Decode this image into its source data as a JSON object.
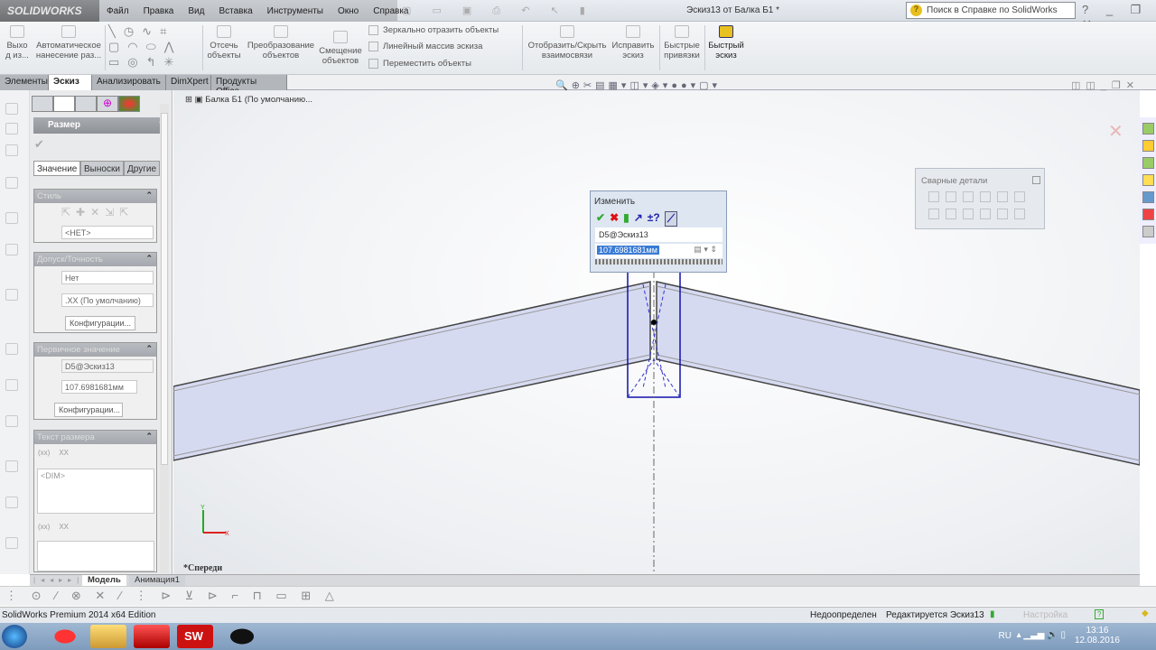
{
  "app": {
    "logo": "SOLIDWORKS",
    "document_title": "Эскиз13 от Балка Б1 *",
    "search_placeholder": "Поиск в Справке по SolidWorks"
  },
  "menu": [
    "Файл",
    "Правка",
    "Вид",
    "Вставка",
    "Инструменты",
    "Окно",
    "Справка"
  ],
  "ribbon": {
    "exit": "Выхо д из...",
    "auto_dim": "Автоматическое нанесение раз...",
    "trim": "Отсечь объекты",
    "convert": "Преобразование объектов",
    "offset": "Смещение объектов",
    "mirror": "Зеркально отразить объекты",
    "linear_pattern": "Линейный массив эскиза",
    "move": "Переместить объекты",
    "relations": "Отобразить/Скрыть взаимосвязи",
    "repair": "Исправить эскиз",
    "quick_snaps": "Быстрые привязки",
    "rapid_sketch": "Быстрый эскиз"
  },
  "tabs": [
    "Элементы",
    "Эскиз",
    "Анализировать",
    "DimXpert",
    "Продукты Office"
  ],
  "active_tab": "Эскиз",
  "property_manager": {
    "title": "Размер",
    "help": "?",
    "subtabs": [
      "Значение",
      "Выноски",
      "Другие"
    ],
    "style": {
      "header": "Стиль",
      "value": "<НЕТ>"
    },
    "tolerance": {
      "header": "Допуск/Точность",
      "tolerance_type": "Нет",
      "precision": ".XX (По умолчанию)",
      "config_button": "Конфигурации..."
    },
    "primary": {
      "header": "Первичное значение",
      "name": "D5@Эскиз13",
      "value": "107.6981681мм",
      "config_button": "Конфигурации..."
    },
    "dim_text": {
      "header": "Текст размера",
      "text": "<DIM>",
      "btn1": "(xx)",
      "btn2": "XX",
      "btn3": "(xx)",
      "btn4": "XX"
    }
  },
  "tree": {
    "root": "Балка Б1  (По умолчанию..."
  },
  "view_label": "*Спереди",
  "modify_dialog": {
    "title": "Изменить",
    "dimension_name": "D5@Эскиз13",
    "value": "107.6981681мм"
  },
  "weldments_toolbar": {
    "title": "Сварные детали"
  },
  "bottom_tabs": [
    "Модель",
    "Анимация1"
  ],
  "status": {
    "product": "SolidWorks Premium 2014 x64 Edition",
    "state": "Недоопределен",
    "editing": "Редактируется Эскиз13",
    "custom": "Настройка"
  },
  "tray": {
    "lang": "RU",
    "time": "13:16",
    "date": "12.08.2016"
  }
}
